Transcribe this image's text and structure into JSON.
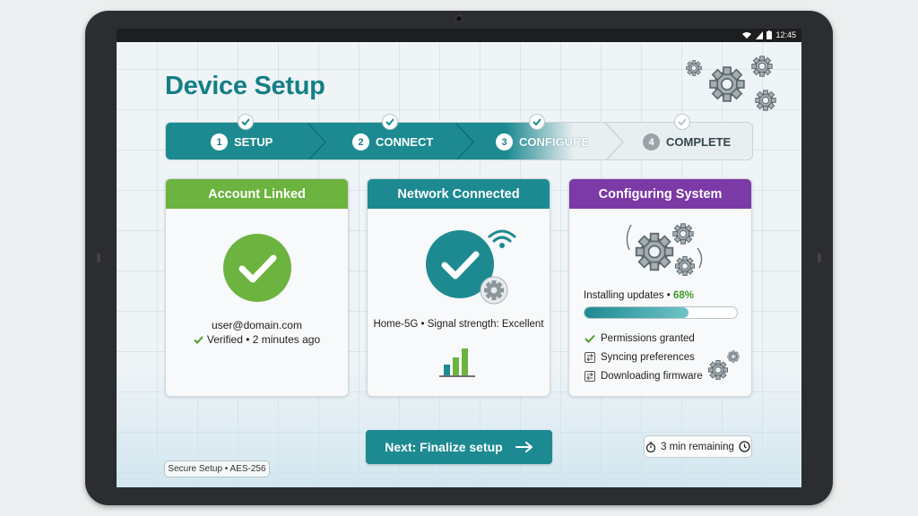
{
  "status_bar": {
    "time": "12:45",
    "icons": [
      "wifi-icon",
      "signal-icon",
      "battery-icon"
    ]
  },
  "page": {
    "title": "Device Setup"
  },
  "steps": [
    {
      "number": "1",
      "label": "SETUP",
      "state": "done"
    },
    {
      "number": "2",
      "label": "CONNECT",
      "state": "done"
    },
    {
      "number": "3",
      "label": "CONFIGURE",
      "state": "active"
    },
    {
      "number": "4",
      "label": "COMPLETE",
      "state": "pending"
    }
  ],
  "cards": {
    "account": {
      "title": "Account Linked",
      "email": "user@domain.com",
      "verified": "Verified • 2 minutes ago",
      "color": "#6cb33f"
    },
    "network": {
      "title": "Network Connected",
      "info": "Home-5G • Signal strength: Excellent",
      "color": "#1d8a91"
    },
    "system": {
      "title": "Configuring System",
      "progress_label": "Installing updates • ",
      "progress_percent": "68%",
      "progress_value": 0.68,
      "tasks": [
        {
          "label": "Permissions granted",
          "state": "done"
        },
        {
          "label": "Syncing preferences",
          "state": "in-progress"
        },
        {
          "label": "Downloading firmware",
          "state": "in-progress"
        }
      ],
      "color": "#7b3aa6"
    }
  },
  "actions": {
    "next_label": "Next: Finalize setup",
    "time_remaining": "3 min remaining"
  },
  "footer": {
    "secure_badge": "Secure Setup • AES-256"
  },
  "colors": {
    "accent": "#1d8a91",
    "success": "#6cb33f",
    "purple": "#7b3aa6",
    "title": "#147f85"
  }
}
